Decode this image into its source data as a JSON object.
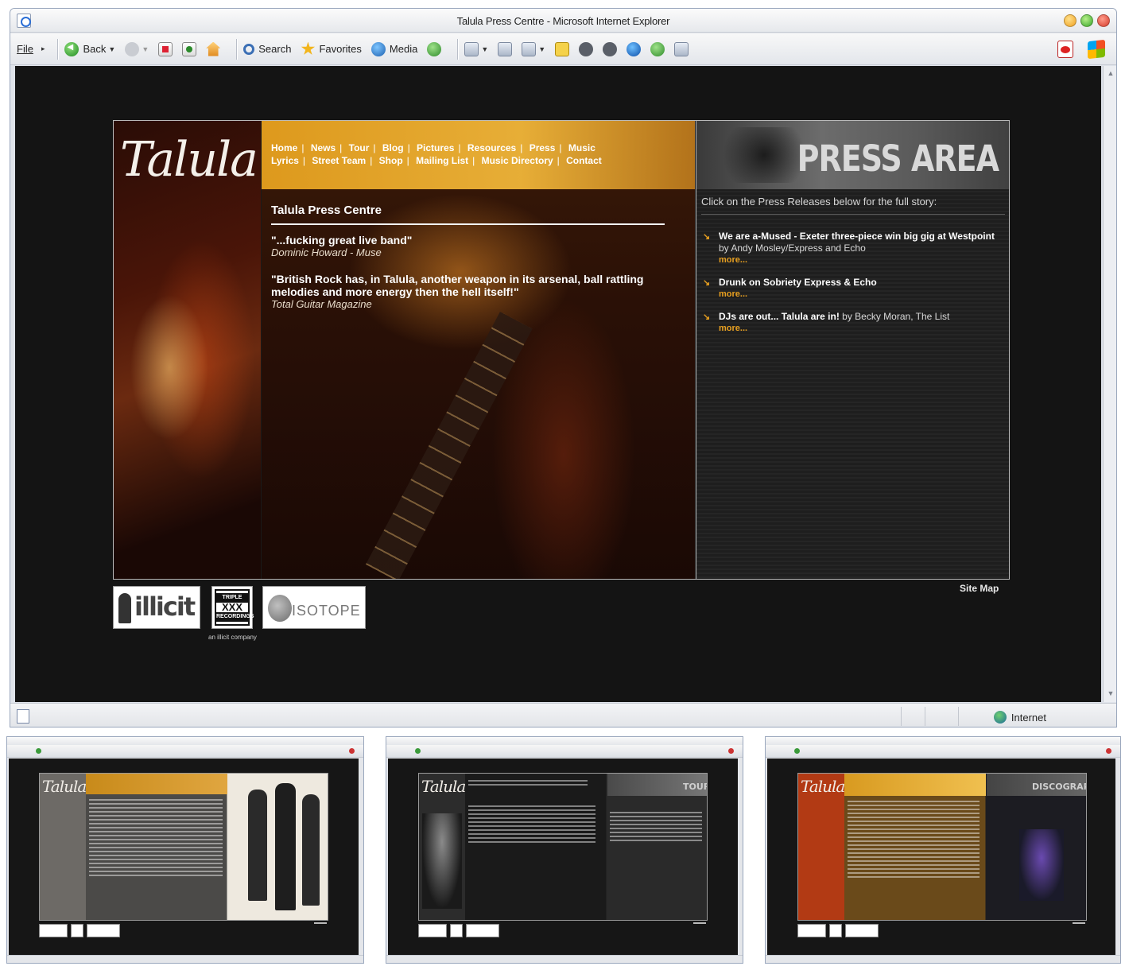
{
  "browser": {
    "title": "Talula Press Centre - Microsoft Internet Explorer",
    "menu": {
      "file": "File"
    },
    "toolbar": {
      "back": "Back",
      "search": "Search",
      "favorites": "Favorites",
      "media": "Media"
    },
    "status": {
      "zone": "Internet"
    }
  },
  "site": {
    "logo": "Talula",
    "nav": {
      "row1": [
        "Home",
        "News",
        "Tour",
        "Blog",
        "Pictures",
        "Resources",
        "Press",
        "Music"
      ],
      "row2": [
        "Lyrics",
        "Street Team",
        "Shop",
        "Mailing List",
        "Music Directory",
        "Contact"
      ]
    },
    "heading": "Talula Press Centre",
    "quotes": [
      {
        "text": "\"...fucking great live band\"",
        "source": "Dominic Howard - Muse"
      },
      {
        "text": "\"British Rock has, in Talula, another weapon in its arsenal, ball rattling melodies and more energy then the hell itself!\"",
        "source": "Total Guitar Magazine"
      }
    ],
    "press_area": {
      "title": "PRESS AREA",
      "intro": "Click on the Press Releases below for the full story:",
      "items": [
        {
          "headline": "We are a-Mused - Exeter three-piece win big gig at Westpoint",
          "byline": " by Andy Mosley/Express and Echo",
          "more": "more..."
        },
        {
          "headline": "Drunk on Sobriety Express & Echo",
          "byline": "",
          "more": "more..."
        },
        {
          "headline": "DJs are out... Talula are in!",
          "byline": " by Becky Moran, The List",
          "more": "more..."
        }
      ]
    },
    "sitemap": "Site Map",
    "badges": {
      "illicit": "illicit",
      "xxx": "XXX",
      "xxx_top": "TRIPLE",
      "xxx_bottom": "RECORDINGS",
      "xxx_caption": "an illicit company",
      "isotope": "ISOTOPE"
    }
  },
  "thumbnails": [
    {
      "heading": "",
      "logo": "Talula"
    },
    {
      "heading": "TOUR",
      "logo": "Talula"
    },
    {
      "heading": "DISCOGRAPHY",
      "logo": "Talula"
    }
  ],
  "colors": {
    "accent": "#e8a020",
    "page_bg": "#141414",
    "nav_orange": "#f2ad2e"
  }
}
